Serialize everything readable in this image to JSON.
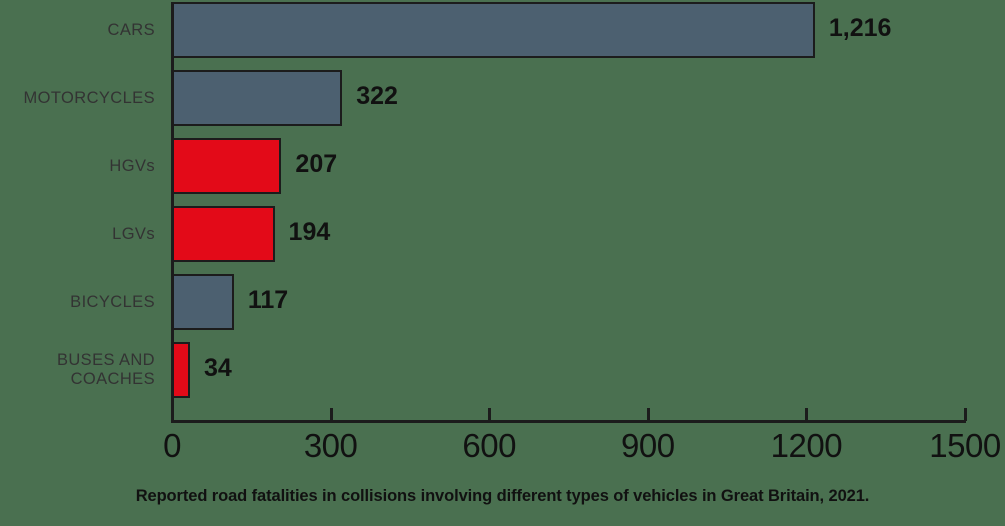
{
  "chart_data": {
    "type": "bar",
    "orientation": "horizontal",
    "title": "",
    "caption": "Reported road fatalities in collisions involving different types of vehicles in Great Britain, 2021.",
    "xlabel": "",
    "ylabel": "",
    "xlim": [
      0,
      1500
    ],
    "xticks": [
      0,
      300,
      600,
      900,
      1200,
      1500
    ],
    "xtick_labels": [
      "0",
      "300",
      "600",
      "900",
      "1200",
      "1500"
    ],
    "grid": false,
    "legend": "none",
    "categories": [
      "CARS",
      "MOTORCYCLES",
      "HGVs",
      "LGVs",
      "BICYCLES",
      "BUSES AND COACHES"
    ],
    "values": [
      1216,
      322,
      207,
      194,
      117,
      34
    ],
    "value_labels": [
      "1,216",
      "322",
      "207",
      "194",
      "117",
      "34"
    ],
    "bar_colors": [
      "#4c6070",
      "#4c6070",
      "#e30a18",
      "#e30a18",
      "#4c6070",
      "#e30a18"
    ],
    "bar_outline_color": "#1c1c1c",
    "background_color": "#4a7050",
    "axis_color": "#1c1c1c",
    "label_color": "#333333",
    "value_label_color": "#111111"
  },
  "bars": [
    {
      "category": "CARS",
      "value": 1216,
      "value_label": "1,216",
      "color_key": "blue"
    },
    {
      "category": "MOTORCYCLES",
      "value": 322,
      "value_label": "322",
      "color_key": "blue"
    },
    {
      "category": "HGVs",
      "value": 207,
      "value_label": "207",
      "color_key": "red"
    },
    {
      "category": "LGVs",
      "value": 194,
      "value_label": "194",
      "color_key": "red"
    },
    {
      "category": "BICYCLES",
      "value": 117,
      "value_label": "117",
      "color_key": "blue"
    },
    {
      "category": "BUSES AND COACHES",
      "value": 34,
      "value_label": "34",
      "color_key": "red"
    }
  ]
}
